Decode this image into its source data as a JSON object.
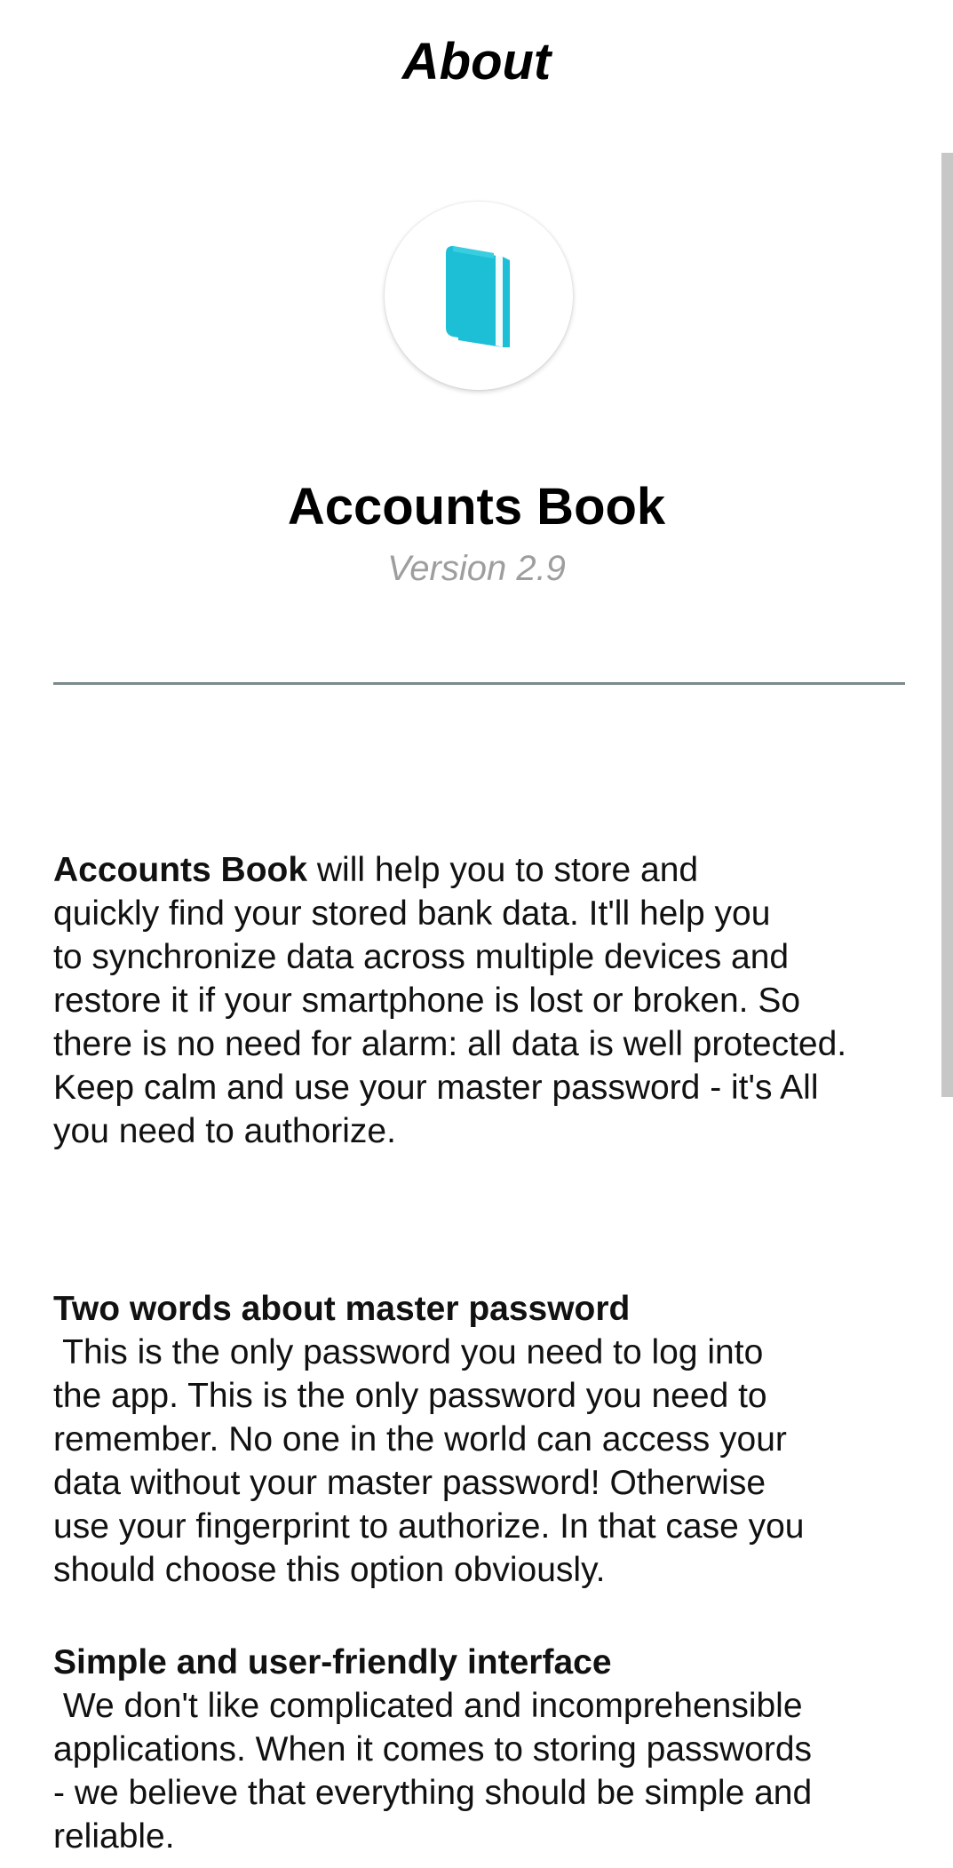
{
  "header": {
    "title": "About"
  },
  "app": {
    "name": "Accounts Book",
    "version": "Version 2.9",
    "icon": "book-icon",
    "icon_color": "#1dbfd6"
  },
  "intro": {
    "app_name_bold": "Accounts Book",
    "lines": [
      " will help you to store and",
      "quickly find your stored bank data. It'll help you",
      "to synchronize data across multiple devices and",
      "restore it if your smartphone is lost or broken. So",
      "there is no need for alarm: all data is well protected.",
      "Keep calm and use your master password - it's All",
      "you need to authorize."
    ]
  },
  "sections": [
    {
      "heading": "Two words about master password",
      "lines": [
        " This is the only password you need to log into",
        "the app. This is the only password you need to",
        "remember. No one in the world can access your",
        "data without your master password! Otherwise",
        "use your fingerprint to authorize. In that case you",
        "should choose this option obviously."
      ]
    },
    {
      "heading": "Simple and user-friendly interface",
      "lines": [
        " We don't like complicated and incomprehensible",
        "applications. When it comes to storing passwords",
        "- we believe that everything should be simple and",
        "reliable."
      ]
    }
  ]
}
